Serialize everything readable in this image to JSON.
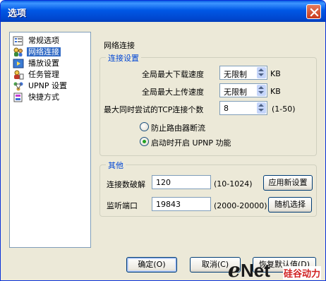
{
  "window": {
    "title": "选项"
  },
  "nav": {
    "items": [
      {
        "label": "常规选项",
        "icon": "settings-list-icon",
        "selected": false
      },
      {
        "label": "网络连接",
        "icon": "network-people-icon",
        "selected": true
      },
      {
        "label": "播放设置",
        "icon": "media-play-icon",
        "selected": false
      },
      {
        "label": "任务管理",
        "icon": "task-people-icon",
        "selected": false
      },
      {
        "label": "UPNP 设置",
        "icon": "upnp-icon",
        "selected": false
      },
      {
        "label": "快捷方式",
        "icon": "shortcut-icon",
        "selected": false
      }
    ]
  },
  "panel": {
    "title": "网络连接",
    "connection": {
      "group_label": "连接设置",
      "max_download_label": "全局最大下载速度",
      "max_download_value": "无限制",
      "max_upload_label": "全局最大上传速度",
      "max_upload_value": "无限制",
      "unit": "KB",
      "max_tcp_label": "最大同时尝试的TCP连接个数",
      "max_tcp_value": "8",
      "max_tcp_range": "(1-50)",
      "radio_router": "防止路由器断流",
      "radio_upnp": "启动时开启 UPNP 功能",
      "selected_radio": "upnp"
    },
    "other": {
      "group_label": "其他",
      "conn_crack_label": "连接数破解",
      "conn_crack_value": "120",
      "conn_crack_range": "(10-1024)",
      "apply_new_button": "应用新设置",
      "listen_port_label": "监听端口",
      "listen_port_value": "19843",
      "listen_port_range": "(2000-20000)",
      "random_button": "随机选择"
    }
  },
  "footer": {
    "ok_button": "确定(O)",
    "cancel_button": "取消(C)",
    "restore_button": "恢复默认值(D)"
  },
  "watermark": {
    "e": "e",
    "net": "Net",
    "tag": "硅谷动力"
  },
  "colors": {
    "titlebar": "#0054e3",
    "group_label": "#0046d5",
    "selection": "#316ac5",
    "dialog_bg": "#ece9d8"
  }
}
